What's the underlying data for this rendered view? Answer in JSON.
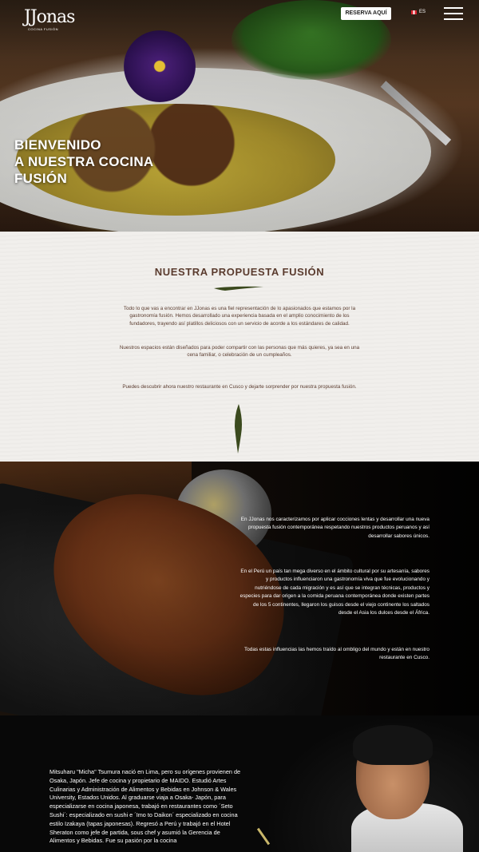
{
  "header": {
    "logo_text": "JJonas",
    "logo_subtext": "COCINA FUSIÓN",
    "reserve_label": "RESERVA AQUÍ",
    "language_label": "ES"
  },
  "hero": {
    "title_line1": "BIENVENIDO",
    "title_line2": "A NUESTRA COCINA",
    "title_line3": "FUSIÓN"
  },
  "propuesta": {
    "title": "NUESTRA PROPUESTA FUSIÓN",
    "paragraph1": "Todo lo que vas a encontrar en JJonas es una fiel representación de lo apasionados que estamos por la gastronomía fusión. Hemos desarrollado una experiencia basada en el amplio conocimiento de los fundadores, trayendo así platillos deliciosos con un servicio de acorde a los estándares de calidad.",
    "paragraph2": "Nuestros espacios están diseñados para poder compartir con las personas que más quieres, ya sea en una cena familiar, o celebración de un cumpleaños.",
    "paragraph3": "Puedes descubrir ahora nuestro restaurante en Cusco y dejarte sorprender por nuestra propuesta fusión."
  },
  "steak": {
    "paragraph1": "En JJonas nos caracterizamos por aplicar cocciones lentas y desarrollar una nueva propuesta fusión contemporánea respetando nuestros productos peruanos y así desarrollar sabores únicos.",
    "paragraph2": "En el Perú un país tan mega diverso en el ámbito cultural por su artesanía, sabores y productos influenciaron una gastronomía viva que fue evolucionando y nutriéndose de cada migración y es así que se integran técnicas, productos y especies para dar origen a la comida peruana contemporánea donde existen partes de los 5 continentes, llegaron los guisos desde el viejo continente los saltados desde el Asia los dulces desde el África.",
    "paragraph3": "Todas estas influencias las hemos traído al ombligo del mundo y están en nuestro restaurante en Cusco."
  },
  "chef": {
    "bio": "Mitsuharu \"Micha\" Tsumura nació en Lima, pero su orígenes provienen de Osaka, Japón. Jefe de cocina y propietario de MAIDO. Estudió Artes Culinarias y Administración de Alimentos y Bebidas en Johnson & Wales University, Estados Unidos. Al graduarse viaja a Osaka- Japón, para especializarse en cocina japonesa, trabajó en restaurantes como ´Seto Sushi´: especializado en sushi e ´Imo to Daikon´ especializado en cocina estilo Izakaya (tapas japonesas). Regresó a Perú y trabajó en el Hotel Sheraton como jefe de partida, sous chef y asumió la Gerencia de Alimentos y Bebidas. Fue su pasión por la cocina"
  },
  "colors": {
    "accent_text": "#5a3b2e",
    "leaf_green": "#3b4a1e",
    "section_bg": "#f1efec"
  }
}
